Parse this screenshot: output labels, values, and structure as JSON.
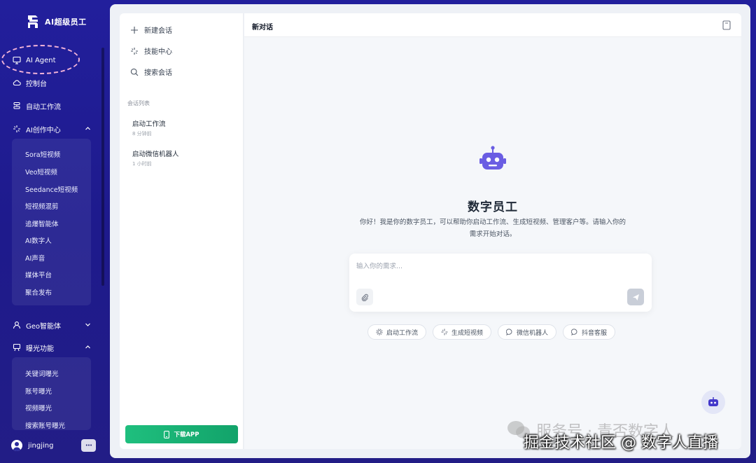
{
  "brand": {
    "name": "AI超级员工"
  },
  "nav": {
    "items": [
      {
        "label": "AI Agent",
        "icon": "monitor-icon"
      },
      {
        "label": "控制台",
        "icon": "cloud-icon"
      },
      {
        "label": "自动工作流",
        "icon": "stack-icon"
      },
      {
        "label": "AI创作中心",
        "icon": "sparkle-icon",
        "expanded": true
      },
      {
        "label": "Geo智能体",
        "icon": "user-icon",
        "expanded": false
      },
      {
        "label": "曝光功能",
        "icon": "easel-icon",
        "expanded": true
      }
    ],
    "ai_creation_sub": [
      "Sora短视频",
      "Veo短视频",
      "Seedance短视频",
      "短视频混剪",
      "追爆智能体",
      "AI数字人",
      "AI声音",
      "媒体平台",
      "聚合发布"
    ],
    "exposure_sub": [
      "关键词曝光",
      "账号曝光",
      "视频曝光",
      "搜索账号曝光"
    ]
  },
  "user": {
    "name": "jingjing",
    "more": "•••"
  },
  "sessions": {
    "actions": [
      {
        "label": "新建会话",
        "icon": "plus-icon"
      },
      {
        "label": "技能中心",
        "icon": "sparkle-icon"
      },
      {
        "label": "搜索会话",
        "icon": "search-icon"
      }
    ],
    "section_title": "会话列表",
    "list": [
      {
        "title": "启动工作流",
        "time": "8 分钟前"
      },
      {
        "title": "启动微信机器人",
        "time": "1 小时前"
      }
    ],
    "download_label": "下载APP"
  },
  "chat": {
    "title": "新对话",
    "hero_title": "数字员工",
    "hero_desc_line1": "你好！我是你的数字员工，可以帮助你启动工作流、生成短视频、管理客户等。请输入你的",
    "hero_desc_line2": "需求开始对话。",
    "input_placeholder": "输入你的需求...",
    "chips": [
      {
        "label": "启动工作流",
        "icon": "gear-icon"
      },
      {
        "label": "生成短视频",
        "icon": "sparkle-icon"
      },
      {
        "label": "微信机器人",
        "icon": "chat-icon"
      },
      {
        "label": "抖音客服",
        "icon": "chat-icon"
      }
    ]
  },
  "watermark": {
    "line1": "服务号 · 青否数字人",
    "line2": "掘金技术社区 @ 数字人直播"
  },
  "colors": {
    "sidebar_bg": "#221f9c",
    "accent_green": "#1fbf7e",
    "robot": "#6a5de3",
    "highlight": "#f2b3d8"
  }
}
